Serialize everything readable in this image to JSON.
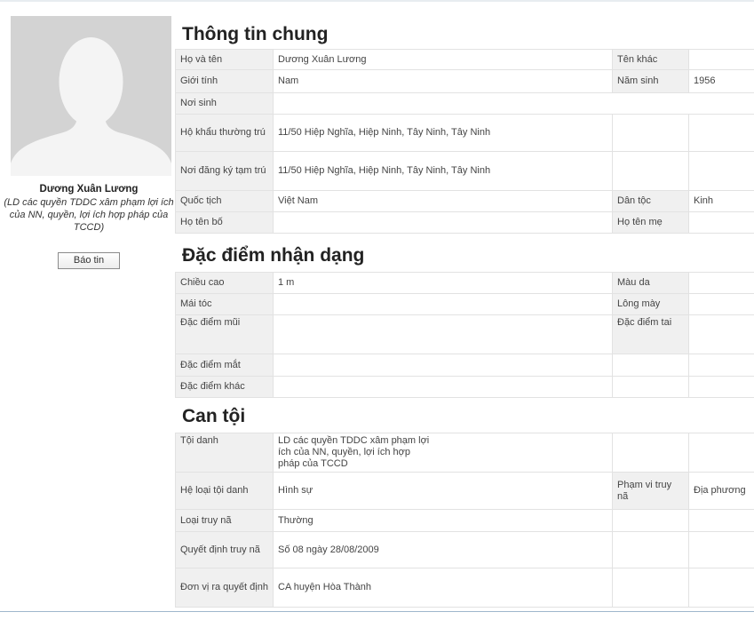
{
  "profile": {
    "name": "Dương Xuân Lương",
    "description": "(LD các quyền TDDC xâm phạm lợi ích của NN, quyền, lợi ích hợp pháp của TCCD)",
    "report_button": "Báo tin"
  },
  "general": {
    "title": "Thông tin chung",
    "full_name_label": "Họ và tên",
    "full_name": "Dương Xuân Lương",
    "alias_label": "Tên khác",
    "alias": "",
    "gender_label": "Giới tính",
    "gender": "Nam",
    "birth_year_label": "Năm sinh",
    "birth_year": "1956",
    "birthplace_label": "Nơi sinh",
    "birthplace": "",
    "permanent_address_label": "Hộ khẩu thường trú",
    "permanent_address": "11/50 Hiệp Nghĩa, Hiệp Ninh, Tây Ninh, Tây Ninh",
    "temporary_address_label": "Nơi đăng ký tạm trú",
    "temporary_address": "11/50 Hiệp Nghĩa, Hiệp Ninh, Tây Ninh, Tây Ninh",
    "nationality_label": "Quốc tịch",
    "nationality": "Việt Nam",
    "ethnicity_label": "Dân tộc",
    "ethnicity": "Kinh",
    "father_label": "Họ tên bố",
    "father": "",
    "mother_label": "Họ tên mẹ",
    "mother": ""
  },
  "identification": {
    "title": "Đặc điểm nhận dạng",
    "height_label": "Chiều cao",
    "height": "1 m",
    "skin_label": "Màu da",
    "skin": "",
    "hair_label": "Mái tóc",
    "hair": "",
    "eyebrow_label": "Lông mày",
    "eyebrow": "",
    "nose_label": "Đặc điểm mũi",
    "nose": "",
    "ear_label": "Đặc điểm tai",
    "ear": "",
    "eye_label": "Đặc điểm mắt",
    "eye": "",
    "other_label": "Đặc điểm khác",
    "other": ""
  },
  "crime": {
    "title": "Can tội",
    "charge_label": "Tội danh",
    "charge": "LD các quyền TDDC xâm phạm lợi ích của NN, quyền, lợi ích hợp pháp của TCCD",
    "category_label": "Hệ loại tội danh",
    "category": "Hình sự",
    "scope_label": "Phạm vi truy nã",
    "scope": "Địa phương",
    "wanted_type_label": "Loại truy nã",
    "wanted_type": "Thường",
    "decision_label": "Quyết định truy nã",
    "decision": "Số 08 ngày 28/08/2009",
    "issuer_label": "Đơn vị ra quyết định",
    "issuer": "CA huyện Hòa Thành"
  }
}
